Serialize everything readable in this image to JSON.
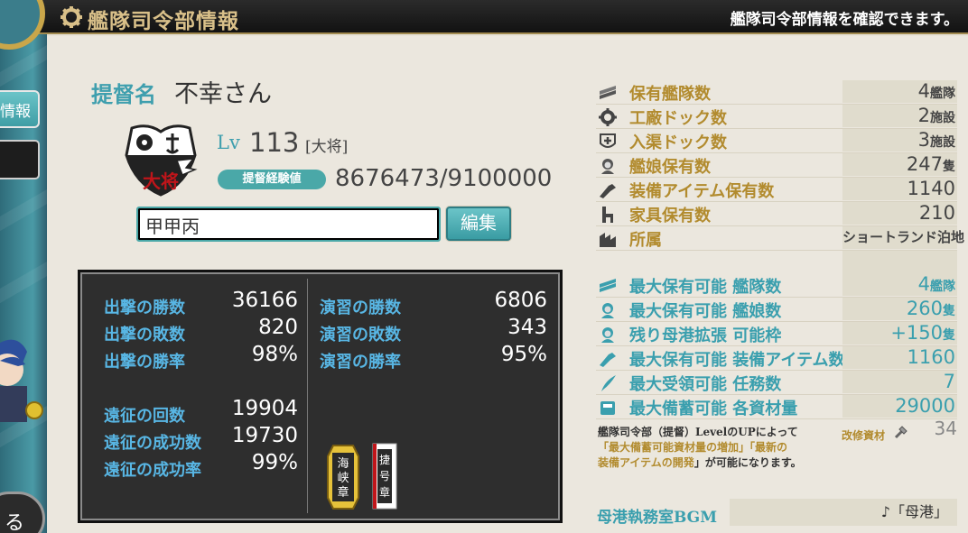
{
  "header": {
    "title": "艦隊司令部情報",
    "description": "艦隊司令部情報を確認できます。"
  },
  "left_nav": {
    "info_tab_label": "情報",
    "round_button_label": "る"
  },
  "admiral": {
    "name_label": "提督名",
    "name": "不幸さん",
    "level_label": "Lv",
    "level": "113",
    "rank": "[大将]",
    "emblem_text": "大将",
    "exp_label": "提督経験値",
    "exp_value": "8676473/9100000",
    "comment": "甲甲丙",
    "edit_button_label": "編集"
  },
  "record": {
    "sortie": [
      {
        "label": "出撃の勝数",
        "value": "36166"
      },
      {
        "label": "出撃の敗数",
        "value": "820"
      },
      {
        "label": "出撃の勝率",
        "value": "98%"
      }
    ],
    "exercise": [
      {
        "label": "演習の勝数",
        "value": "6806"
      },
      {
        "label": "演習の敗数",
        "value": "343"
      },
      {
        "label": "演習の勝率",
        "value": "95%"
      }
    ],
    "expedition": [
      {
        "label": "遠征の回数",
        "value": "19904"
      },
      {
        "label": "遠征の成功数",
        "value": "19730"
      },
      {
        "label": "遠征の成功率",
        "value": "99%"
      }
    ],
    "medals": [
      "海峡章",
      "捷号章"
    ]
  },
  "stats": [
    {
      "icon": "fleet-icon",
      "label": "保有艦隊数",
      "value": "4",
      "unit": "艦隊"
    },
    {
      "icon": "gear-icon",
      "label": "工廠ドック数",
      "value": "2",
      "unit": "施設"
    },
    {
      "icon": "repair-icon",
      "label": "入渠ドック数",
      "value": "3",
      "unit": "施設"
    },
    {
      "icon": "shipgirl-icon",
      "label": "艦娘保有数",
      "value": "247",
      "unit": "隻"
    },
    {
      "icon": "equipment-icon",
      "label": "装備アイテム保有数",
      "value": "1140",
      "unit": ""
    },
    {
      "icon": "furniture-icon",
      "label": "家具保有数",
      "value": "210",
      "unit": ""
    },
    {
      "icon": "base-icon",
      "label": "所属",
      "value": "ショートランド泊地",
      "unit": ""
    }
  ],
  "max_stats": [
    {
      "icon": "fleet-icon",
      "label": "最大保有可能 艦隊数",
      "value": "4",
      "unit": "艦隊"
    },
    {
      "icon": "shipgirl-icon",
      "label": "最大保有可能 艦娘数",
      "value": "260",
      "unit": "隻"
    },
    {
      "icon": "shipgirl-icon",
      "label": "残り母港拡張 可能枠",
      "value": "+150",
      "unit": "隻"
    },
    {
      "icon": "equipment-icon",
      "label": "最大保有可能 装備アイテム数",
      "value": "1160",
      "unit": ""
    },
    {
      "icon": "quill-icon",
      "label": "最大受領可能 任務数",
      "value": "7",
      "unit": ""
    },
    {
      "icon": "storage-icon",
      "label": "最大備蓄可能 各資材量",
      "value": "29000",
      "unit": ""
    }
  ],
  "note": {
    "line1": "艦隊司令部（提督）LevelのUPによって",
    "line2": "「最大備蓄可能資材量の増加」「最新の",
    "line3_highlight": "装備アイテムの開発",
    "line3_rest": "」が可能になります。"
  },
  "improvement": {
    "label": "改修資材",
    "value": "34"
  },
  "bgm": {
    "label": "母港執務室BGM",
    "value": "♪「母港」"
  },
  "colors": {
    "accent_teal": "#3a9fae",
    "accent_gold": "#b28b2e",
    "header_bg": "#1a1a1a",
    "record_label": "#58b6e4"
  }
}
